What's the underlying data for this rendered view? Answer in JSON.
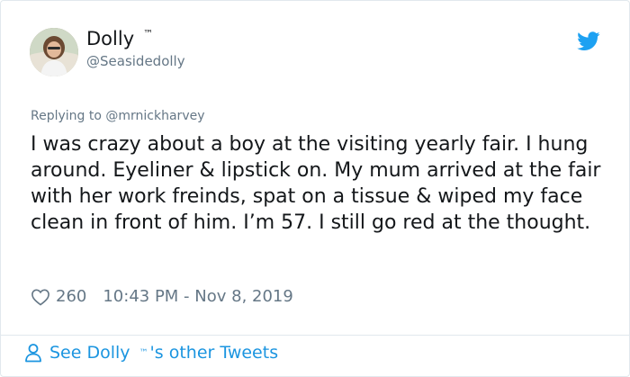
{
  "tweet": {
    "author_name": "Dolly",
    "author_trademark": "™",
    "handle": "@Seasidedolly",
    "replying_prefix": "Replying to",
    "replying_to": "@mrnickharvey",
    "text": "I was crazy about a boy at the visiting yearly fair. I hung around. Eyeliner & lipstick on. My mum arrived at the fair with her work freinds, spat on a tissue & wiped my face clean in front of him. I’m 57. I still go red at the thought.",
    "likes": "260",
    "timestamp": "10:43 PM - Nov 8, 2019"
  },
  "footer": {
    "prefix": "See Dolly",
    "trademark": "™",
    "suffix": "'s other Tweets"
  },
  "icons": {
    "brand": "twitter-bird-icon",
    "like": "heart-icon",
    "profile": "person-icon"
  },
  "colors": {
    "twitter_blue": "#1da1f2",
    "link_blue": "#1b95e0",
    "muted": "#657786",
    "text": "#14171a",
    "border": "#e1e8ed"
  }
}
